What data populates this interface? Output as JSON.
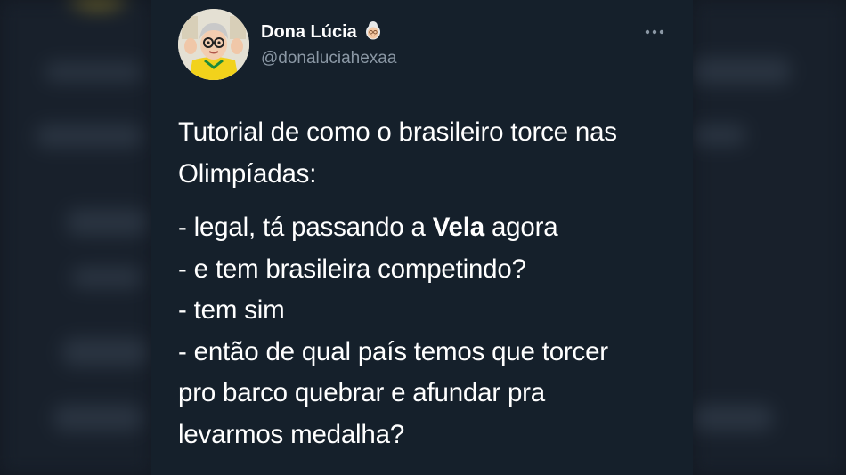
{
  "tweet": {
    "author": {
      "display_name": "Dona Lúcia",
      "name_emoji_icon": "old-woman-emoji-icon",
      "handle": "@donaluciahexaa",
      "avatar_icon": "profile-avatar"
    },
    "more_icon": "more-options-icon",
    "paragraph1": [
      "Tutorial de como o brasileiro torce nas",
      "Olimpíadas:"
    ],
    "line_vela": {
      "prefix": "- legal, tá passando a ",
      "bold": "Vela",
      "suffix": " agora"
    },
    "lines": [
      "- e tem brasileira competindo?",
      "- tem sim",
      "- então de qual país temos que torcer",
      "pro barco quebrar e afundar pra",
      "levarmos medalha?"
    ]
  },
  "colors": {
    "card_background": "#15202b",
    "text_primary": "#ffffff",
    "text_secondary": "#8b98a5",
    "page_background": "#131922"
  }
}
